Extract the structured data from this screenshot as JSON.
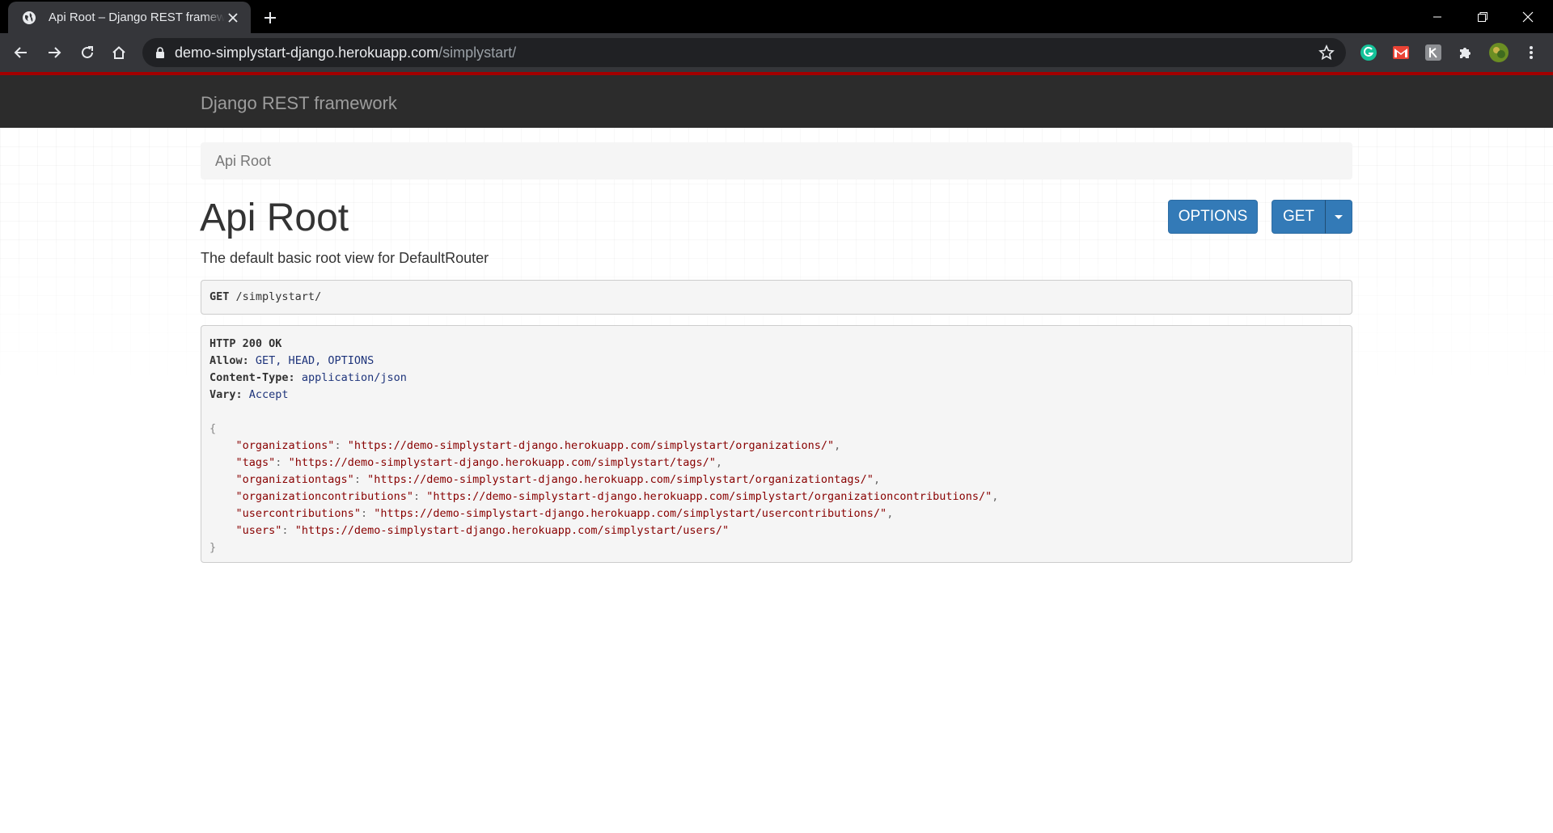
{
  "browser": {
    "tab_title": "Api Root – Django REST framework",
    "url_host": "demo-simplystart-django.herokuapp.com",
    "url_path": "/simplystart/",
    "extensions": [
      "grammarly-icon",
      "gmail-icon",
      "extension-icon",
      "puzzle-icon",
      "avatar"
    ]
  },
  "navbar": {
    "brand": "Django REST framework"
  },
  "breadcrumb": {
    "items": [
      "Api Root"
    ]
  },
  "page": {
    "title": "Api Root",
    "description": "The default basic root view for DefaultRouter"
  },
  "buttons": {
    "options": "OPTIONS",
    "get": "GET"
  },
  "request": {
    "method": "GET",
    "path": "/simplystart/"
  },
  "response": {
    "status": "HTTP 200 OK",
    "headers": [
      {
        "name": "Allow:",
        "value": "GET, HEAD, OPTIONS"
      },
      {
        "name": "Content-Type:",
        "value": "application/json"
      },
      {
        "name": "Vary:",
        "value": "Accept"
      }
    ],
    "open_brace": "{",
    "close_brace": "}",
    "body": [
      {
        "key": "\"organizations\"",
        "url": "\"https://demo-simplystart-django.herokuapp.com/simplystart/organizations/\"",
        "comma": ","
      },
      {
        "key": "\"tags\"",
        "url": "\"https://demo-simplystart-django.herokuapp.com/simplystart/tags/\"",
        "comma": ","
      },
      {
        "key": "\"organizationtags\"",
        "url": "\"https://demo-simplystart-django.herokuapp.com/simplystart/organizationtags/\"",
        "comma": ","
      },
      {
        "key": "\"organizationcontributions\"",
        "url": "\"https://demo-simplystart-django.herokuapp.com/simplystart/organizationcontributions/\"",
        "comma": ","
      },
      {
        "key": "\"usercontributions\"",
        "url": "\"https://demo-simplystart-django.herokuapp.com/simplystart/usercontributions/\"",
        "comma": ","
      },
      {
        "key": "\"users\"",
        "url": "\"https://demo-simplystart-django.herokuapp.com/simplystart/users/\"",
        "comma": ""
      }
    ]
  },
  "colors": {
    "navbar_bg": "#2c2c2c",
    "navbar_accent": "#a30000",
    "button_primary": "#337ab7",
    "json_string": "#880000",
    "json_literal": "#1e347b"
  }
}
